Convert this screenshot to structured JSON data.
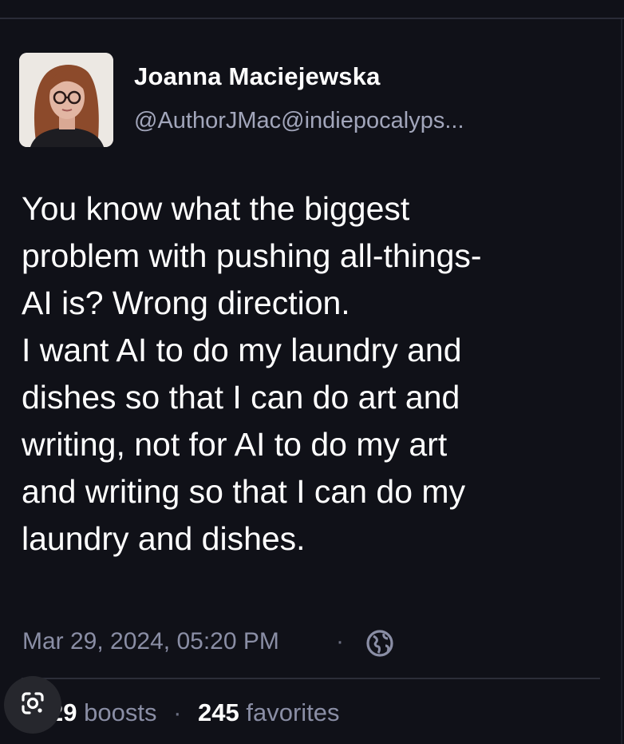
{
  "author": {
    "display_name": "Joanna Maciejewska",
    "handle": "@AuthorJMac@indiepocalyps..."
  },
  "post": {
    "lines": [
      "You know what the biggest",
      "problem with pushing all-things-",
      "AI is? Wrong direction.",
      "I want AI to do my laundry and",
      "dishes so that I can do art and",
      "writing, not for AI to do my art",
      "and writing so that I can do my",
      "laundry and dishes."
    ]
  },
  "meta": {
    "timestamp": "Mar 29, 2024, 05:20 PM",
    "separator": "·",
    "visibility_icon": "globe-icon"
  },
  "stats": {
    "boosts_count": "29",
    "boosts_label": "boosts",
    "separator": "·",
    "favorites_count": "245",
    "favorites_label": "favorites"
  },
  "overlay": {
    "icon": "google-lens-icon"
  },
  "colors": {
    "background": "#101118",
    "primary_text": "#ffffff",
    "secondary_text": "#8a8ea5",
    "handle_text": "#a2a6bb"
  }
}
